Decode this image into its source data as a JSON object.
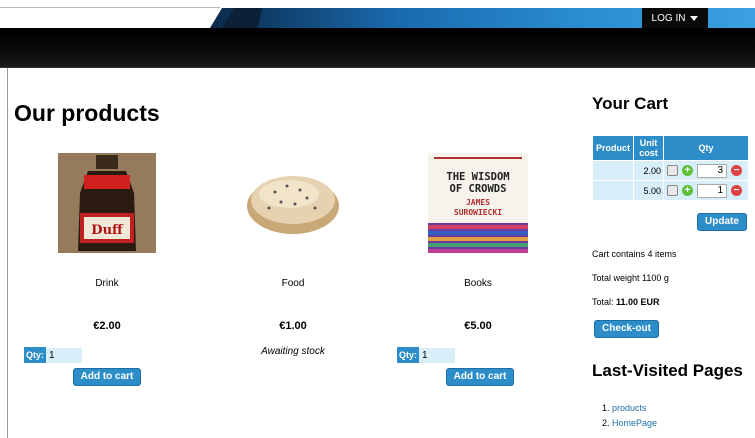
{
  "nav": {
    "login_label": "LOG IN"
  },
  "main": {
    "title": "Our products",
    "products": [
      {
        "name": "Drink",
        "price": "€2.00",
        "qty_label": "Qty:",
        "qty_value": "1",
        "button": "Add to cart"
      },
      {
        "name": "Food",
        "price": "€1.00",
        "stock": "Awaiting stock"
      },
      {
        "name": "Books",
        "price": "€5.00",
        "qty_label": "Qty:",
        "qty_value": "1",
        "button": "Add to cart"
      }
    ],
    "book_cover": {
      "line1": "THE WISDOM",
      "line2": "OF CROWDS",
      "author1": "JAMES",
      "author2": "SUROWIECKI"
    },
    "drink_logo": "Duff"
  },
  "cart": {
    "title": "Your Cart",
    "headers": {
      "product": "Product",
      "unit_cost": "Unit cost",
      "qty": "Qty"
    },
    "rows": [
      {
        "product": "",
        "unit_cost": "2.00",
        "qty": "3"
      },
      {
        "product": "",
        "unit_cost": "5.00",
        "qty": "1"
      }
    ],
    "update_button": "Update",
    "items_text": "Cart contains 4 items",
    "weight_text": "Total weight 1100 g",
    "total_label": "Total:",
    "total_value": "11.00 EUR",
    "checkout_button": "Check-out"
  },
  "visited": {
    "title": "Last-Visited Pages",
    "links": [
      "products",
      "HomePage"
    ]
  }
}
